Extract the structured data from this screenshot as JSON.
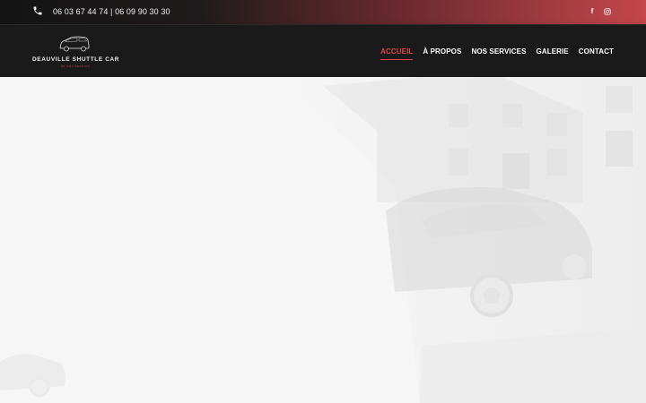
{
  "topbar": {
    "phone": "06 03 67 44 74 | 06 09 90 30 30",
    "phone_icon": "phone-icon",
    "social": [
      {
        "name": "facebook-icon",
        "glyph": "f"
      },
      {
        "name": "instagram-icon",
        "glyph": "◎"
      }
    ]
  },
  "header": {
    "logo": {
      "title": "DEAUVILLE SHUTTLE CAR",
      "subtitle": "DE VOS BESOINS",
      "icon": "car-logo-icon"
    },
    "nav": [
      {
        "label": "ACCUEIL",
        "active": true
      },
      {
        "label": "À PROPOS",
        "active": false
      },
      {
        "label": "NOS SERVICES",
        "active": false
      },
      {
        "label": "GALERIE",
        "active": false
      },
      {
        "label": "CONTACT",
        "active": false
      }
    ]
  },
  "colors": {
    "accent": "#e0474d",
    "header_bg": "#1b1a1a",
    "topbar_gradient_end": "#c4464b",
    "hero_bg": "#f6f6f6"
  }
}
